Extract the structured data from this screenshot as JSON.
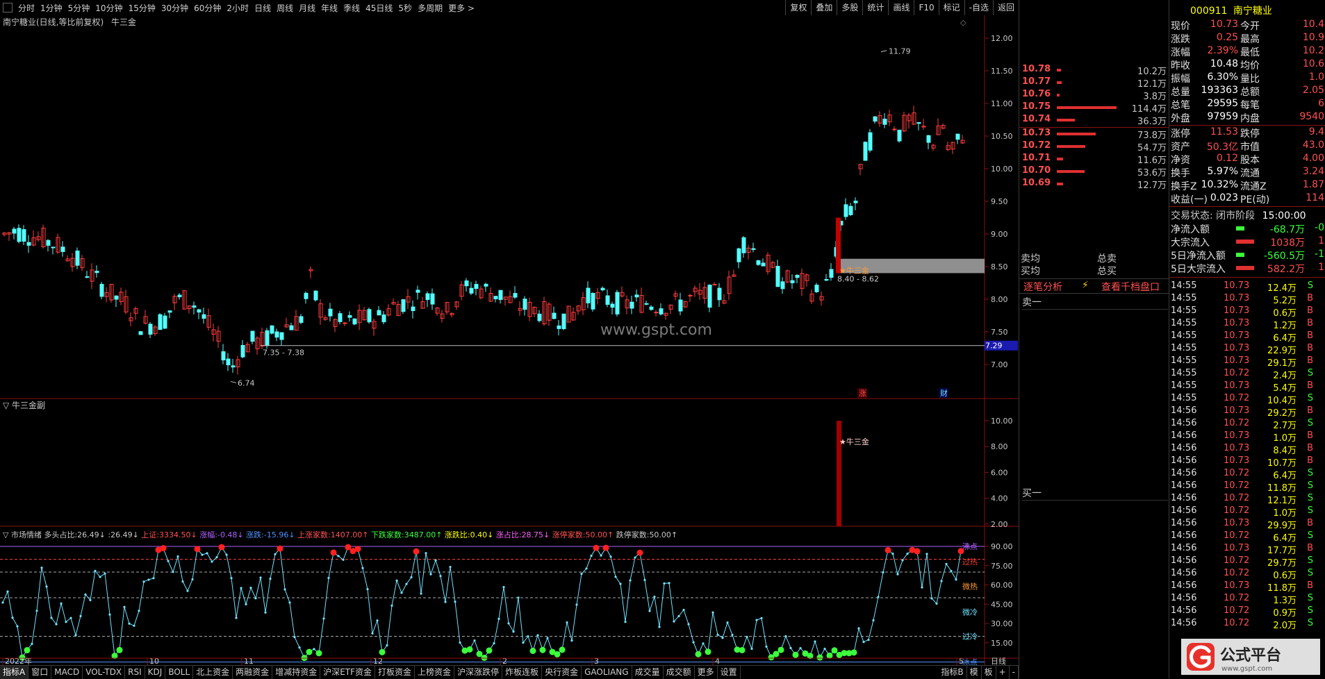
{
  "toolbar": {
    "periods": [
      "分时",
      "1分钟",
      "5分钟",
      "10分钟",
      "15分钟",
      "30分钟",
      "60分钟",
      "2小时",
      "日线",
      "周线",
      "月线",
      "年线",
      "季线",
      "45日线",
      "5秒",
      "多周期",
      "更多 >"
    ],
    "right_buttons": [
      "复权",
      "叠加",
      "多股",
      "统计",
      "画线",
      "F10",
      "标记",
      "-自选",
      "返回"
    ]
  },
  "main_chart": {
    "title": "南宁糖业(日线,等比前复权)",
    "indicator_name": "牛三金",
    "price_ticks": [
      "12.00",
      "11.50",
      "11.00",
      "10.50",
      "10.00",
      "9.50",
      "9.00",
      "8.50",
      "8.00",
      "7.50",
      "7.00"
    ],
    "current_price_label": "7.29",
    "high_label": "11.79",
    "low_label": "6.74",
    "range_label_1": "7.35 - 7.38",
    "range_label_2": "8.40 - 8.62",
    "signal_label": "牛三金",
    "marker_zhang": "涨",
    "marker_cai": "财",
    "watermark": "www.gspt.com",
    "colors": {
      "up": "#ff3c3c",
      "down": "#54ffff",
      "background": "#000000"
    }
  },
  "sub1": {
    "title": "牛三金副",
    "ticks": [
      "10.00",
      "8.00",
      "6.00",
      "4.00",
      "2.00"
    ],
    "signal_label": "牛三金"
  },
  "sub2": {
    "title": "市场情绪",
    "stats": [
      {
        "label": "多头占比:",
        "value": "26.49↓",
        "color": "#c8c8c8"
      },
      {
        "label": ":",
        "value": "26.49↓",
        "color": "#c8c8c8"
      },
      {
        "label": "上证:",
        "value": "3334.50↓",
        "color": "#ff5050"
      },
      {
        "label": "涨幅:",
        "value": "-0.48↓",
        "color": "#b060ff"
      },
      {
        "label": "涨跌:",
        "value": "-15.96↓",
        "color": "#5090ff"
      },
      {
        "label": "上涨家数:",
        "value": "1407.00↑",
        "color": "#ff5050"
      },
      {
        "label": "下跌家数:",
        "value": "3487.00↑",
        "color": "#3cff3c"
      },
      {
        "label": "涨跌比:",
        "value": "0.40↓",
        "color": "#ffff00"
      },
      {
        "label": "涨占比:",
        "value": "28.75↓",
        "color": "#ff60ff"
      },
      {
        "label": "涨停家数:",
        "value": "50.00↑",
        "color": "#ff5050"
      },
      {
        "label": "跌停家数:",
        "value": "50.00↑",
        "color": "#c8c8c8"
      }
    ],
    "ticks": [
      "90.00",
      "75.00",
      "60.00",
      "45.00",
      "30.00",
      "15.00"
    ],
    "zones": [
      "沸点",
      "过热",
      "微热",
      "微冷",
      "过冷",
      "冰点"
    ],
    "dates": [
      "2022年",
      "10",
      "11",
      "12",
      "2",
      "3",
      "4",
      "5"
    ],
    "cycle_label": "日线"
  },
  "orderbook": {
    "sells": [
      {
        "price": "10.78",
        "vol": "10.2万",
        "bar": 0.07
      },
      {
        "price": "10.77",
        "vol": "12.1万",
        "bar": 0.08
      },
      {
        "price": "10.76",
        "vol": "3.8万",
        "bar": 0.03
      },
      {
        "price": "10.75",
        "vol": "114.4万",
        "bar": 1.0
      },
      {
        "price": "10.74",
        "vol": "36.3万",
        "bar": 0.3
      }
    ],
    "buys": [
      {
        "price": "10.73",
        "vol": "73.8万",
        "bar": 0.65
      },
      {
        "price": "10.72",
        "vol": "54.7万",
        "bar": 0.48
      },
      {
        "price": "10.71",
        "vol": "11.6万",
        "bar": 0.1
      },
      {
        "price": "10.70",
        "vol": "53.6万",
        "bar": 0.47
      },
      {
        "price": "10.69",
        "vol": "12.7万",
        "bar": 0.11
      }
    ],
    "sell_avg_label": "卖均",
    "buy_avg_label": "买均",
    "total_sell_label": "总卖",
    "total_buy_label": "总买",
    "tab_trades": "逐笔分析",
    "tab_depth": "查看千档盘口",
    "sell1": "卖一",
    "buy1": "买一"
  },
  "stock": {
    "code": "000911",
    "name": "南宁糖业",
    "fields": [
      [
        "现价",
        "10.73",
        "今开",
        "10.4"
      ],
      [
        "涨跌",
        "0.25",
        "最高",
        "10.9"
      ],
      [
        "涨幅",
        "2.39%",
        "最低",
        "10.2"
      ],
      [
        "昨收",
        "10.48",
        "均价",
        "10.6"
      ],
      [
        "振幅",
        "6.30%",
        "量比",
        "1.0"
      ],
      [
        "总量",
        "193363",
        "总额",
        "2.05"
      ],
      [
        "总笔",
        "29595",
        "每笔",
        "6"
      ],
      [
        "外盘",
        "97959",
        "内盘",
        "9540"
      ]
    ],
    "fields2": [
      [
        "涨停",
        "11.53",
        "跌停",
        "9.4"
      ],
      [
        "资产",
        "50.3亿",
        "市值",
        "43.0"
      ],
      [
        "净资",
        "0.12",
        "股本",
        "4.00"
      ],
      [
        "换手",
        "5.97%",
        "流通",
        "3.24"
      ],
      [
        "换手Z",
        "10.32%",
        "流通Z",
        "1.87"
      ],
      [
        "收益(一)",
        "0.023",
        "PE(动)",
        "114"
      ]
    ],
    "status_label": "交易状态: 闭市阶段",
    "status_time": "15:00:00",
    "flows": [
      [
        "净流入额",
        "-68.7万",
        "-0"
      ],
      [
        "大宗流入",
        "1038万",
        "1"
      ],
      [
        "5日净流入额",
        "-560.5万",
        "-1"
      ],
      [
        "5日大宗流入",
        "582.2万",
        "1"
      ]
    ]
  },
  "trades": [
    [
      "14:55",
      "10.73",
      "12.4万",
      "S"
    ],
    [
      "14:55",
      "10.73",
      "5.2万",
      "B"
    ],
    [
      "14:55",
      "10.73",
      "0.6万",
      "B"
    ],
    [
      "14:55",
      "10.73",
      "1.2万",
      "B"
    ],
    [
      "14:55",
      "10.73",
      "6.4万",
      "B"
    ],
    [
      "14:55",
      "10.73",
      "22.9万",
      "B"
    ],
    [
      "14:55",
      "10.73",
      "29.1万",
      "B"
    ],
    [
      "14:55",
      "10.72",
      "2.4万",
      "S"
    ],
    [
      "14:55",
      "10.73",
      "5.4万",
      "B"
    ],
    [
      "14:55",
      "10.72",
      "10.4万",
      "S"
    ],
    [
      "14:56",
      "10.73",
      "29.2万",
      "B"
    ],
    [
      "14:56",
      "10.72",
      "2.7万",
      "S"
    ],
    [
      "14:56",
      "10.73",
      "1.0万",
      "B"
    ],
    [
      "14:56",
      "10.73",
      "8.4万",
      "B"
    ],
    [
      "14:56",
      "10.73",
      "10.7万",
      "B"
    ],
    [
      "14:56",
      "10.72",
      "6.4万",
      "S"
    ],
    [
      "14:56",
      "10.72",
      "11.8万",
      "S"
    ],
    [
      "14:56",
      "10.72",
      "12.1万",
      "S"
    ],
    [
      "14:56",
      "10.72",
      "1.0万",
      "S"
    ],
    [
      "14:56",
      "10.73",
      "29.9万",
      "B"
    ],
    [
      "14:56",
      "10.72",
      "6.4万",
      "S"
    ],
    [
      "14:56",
      "10.73",
      "17.7万",
      "B"
    ],
    [
      "14:56",
      "10.72",
      "29.7万",
      "S"
    ],
    [
      "14:56",
      "10.72",
      "0.6万",
      "S"
    ],
    [
      "14:56",
      "10.73",
      "11.8万",
      "B"
    ],
    [
      "14:56",
      "10.72",
      "1.3万",
      "S"
    ],
    [
      "14:56",
      "10.72",
      "0.9万",
      "S"
    ],
    [
      "14:56",
      "10.72",
      "2.0万",
      "S"
    ]
  ],
  "brand": {
    "logo_text": "公式平台",
    "logo_url": "www.gspt.com"
  },
  "bottom_tabs": [
    "指标A",
    "窗口",
    "MACD",
    "VOL-TDX",
    "RSI",
    "KDJ",
    "BOLL",
    "北上资金",
    "两融资金",
    "增减持资金",
    "沪深ETF资金",
    "打板资金",
    "上榜资金",
    "沪深涨跌停",
    "炸板连板",
    "央行资金",
    "GAOLIANG",
    "成交量",
    "成交额",
    "更多",
    "设置"
  ],
  "bottom_right": [
    "指标B",
    "模",
    "板",
    "+",
    "-"
  ]
}
